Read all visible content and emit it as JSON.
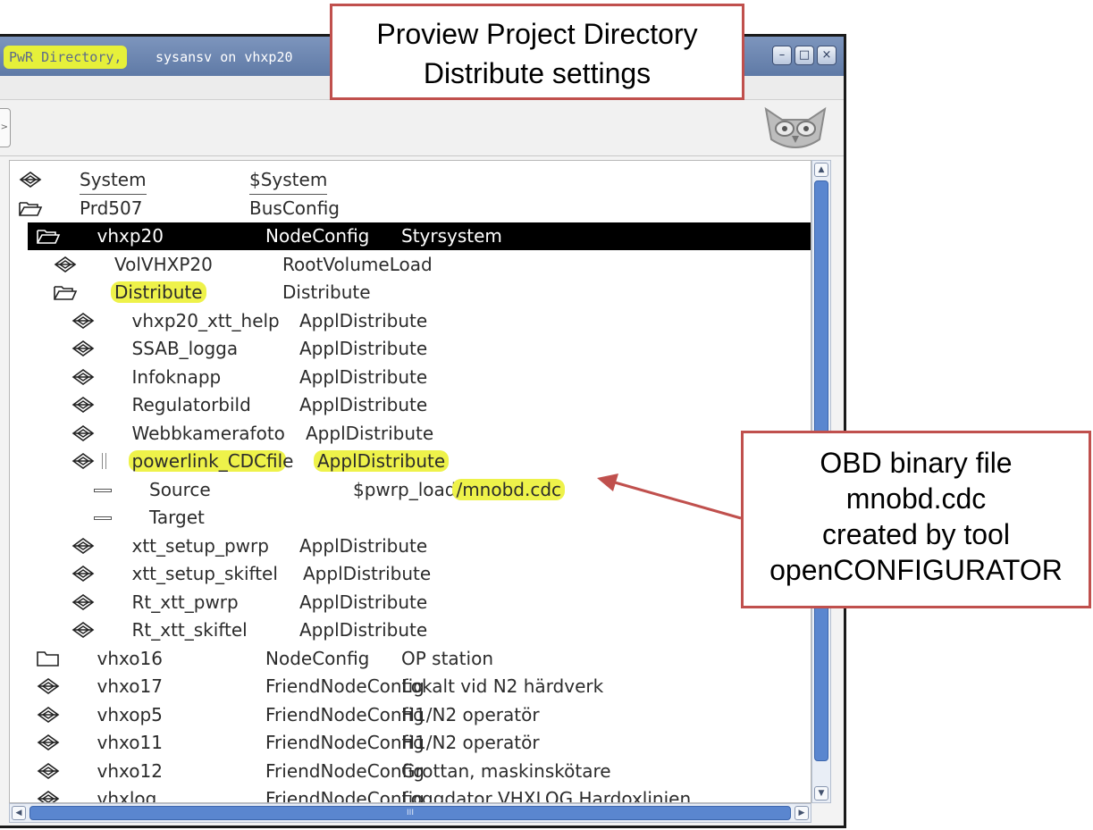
{
  "window": {
    "title_highlight": "PwR Directory,",
    "title_rest": "sysansv on vhxp20",
    "controls": {
      "minimize": "–",
      "maximize": "□",
      "close": "×"
    },
    "toolbar_button_glyph": ">"
  },
  "tree": {
    "rows": [
      {
        "name": "System",
        "class": "$System",
        "desc": "",
        "icon": "object-icon"
      },
      {
        "name": "Prd507",
        "class": "BusConfig",
        "desc": "",
        "icon": "open-folder-icon"
      },
      {
        "name": "vhxp20",
        "class": "NodeConfig",
        "desc": "Styrsystem",
        "icon": "open-folder-icon",
        "selected": true
      },
      {
        "name": "VolVHXP20",
        "class": "RootVolumeLoad",
        "desc": "",
        "icon": "object-icon"
      },
      {
        "name": "Distribute",
        "class": "Distribute",
        "desc": "",
        "icon": "open-folder-icon"
      },
      {
        "name": "vhxp20_xtt_help",
        "class": "ApplDistribute",
        "desc": "",
        "icon": "object-icon"
      },
      {
        "name": "SSAB_logga",
        "class": "ApplDistribute",
        "desc": "",
        "icon": "object-icon"
      },
      {
        "name": "Infoknapp",
        "class": "ApplDistribute",
        "desc": "",
        "icon": "object-icon"
      },
      {
        "name": "Regulatorbild",
        "class": "ApplDistribute",
        "desc": "",
        "icon": "object-icon"
      },
      {
        "name": "Webbkamerafoto",
        "class": "ApplDistribute",
        "desc": "",
        "icon": "object-icon"
      },
      {
        "name": "powerlink_CDCfile",
        "class": "ApplDistribute",
        "desc": "",
        "icon": "object-icon"
      },
      {
        "name": "Source",
        "value": "$pwrp_load/mnobd.cdc",
        "value_prefix": "$pwrp_load",
        "value_suffix": "/mnobd.cdc",
        "icon": "attribute-icon"
      },
      {
        "name": "Target",
        "value": "",
        "icon": "attribute-icon"
      },
      {
        "name": "xtt_setup_pwrp",
        "class": "ApplDistribute",
        "desc": "",
        "icon": "object-icon"
      },
      {
        "name": "xtt_setup_skiftel",
        "class": "ApplDistribute",
        "desc": "",
        "icon": "object-icon"
      },
      {
        "name": "Rt_xtt_pwrp",
        "class": "ApplDistribute",
        "desc": "",
        "icon": "object-icon"
      },
      {
        "name": "Rt_xtt_skiftel",
        "class": "ApplDistribute",
        "desc": "",
        "icon": "object-icon"
      },
      {
        "name": "vhxo16",
        "class": "NodeConfig",
        "desc": "OP station",
        "icon": "closed-folder-icon"
      },
      {
        "name": "vhxo17",
        "class": "FriendNodeConfig",
        "desc": "Lokalt vid N2 härdverk",
        "icon": "object-icon"
      },
      {
        "name": "vhxop5",
        "class": "FriendNodeConfig",
        "desc": "H1/N2 operatör",
        "icon": "object-icon"
      },
      {
        "name": "vhxo11",
        "class": "FriendNodeConfig",
        "desc": "H1/N2 operatör",
        "icon": "object-icon"
      },
      {
        "name": "vhxo12",
        "class": "FriendNodeConfig",
        "desc": "Grottan, maskinskötare",
        "icon": "object-icon"
      },
      {
        "name": "vhxlog",
        "class": "FriendNodeConfig",
        "desc": "Loggdator VHXLOG Hardoxlinjen",
        "icon": "object-icon"
      }
    ]
  },
  "scrollbars": {
    "up": "▲",
    "down": "▼",
    "left": "◀",
    "right": "▶",
    "grip": "III"
  },
  "annotations": {
    "top": {
      "line1": "Proview Project Directory",
      "line2": "Distribute settings"
    },
    "right": {
      "line1": "OBD binary file",
      "line2": "mnobd.cdc",
      "line3": "created by tool",
      "line4": "openCONFIGURATOR"
    }
  },
  "colors": {
    "highlight": "#eef24a",
    "callout_border": "#c0504d",
    "selection": "#000000",
    "scroll_thumb": "#5a86cf"
  }
}
